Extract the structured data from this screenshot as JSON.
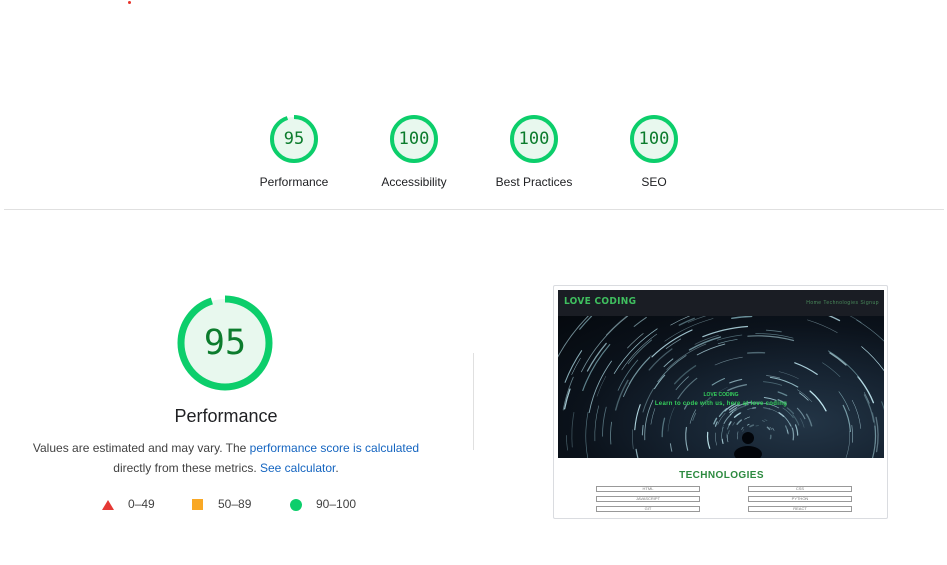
{
  "scores": [
    {
      "value": "95",
      "label": "Performance",
      "fraction": 0.95
    },
    {
      "value": "100",
      "label": "Accessibility",
      "fraction": 1.0
    },
    {
      "value": "100",
      "label": "Best Practices",
      "fraction": 1.0
    },
    {
      "value": "100",
      "label": "SEO",
      "fraction": 1.0
    }
  ],
  "main": {
    "score": "95",
    "fraction": 0.95,
    "title": "Performance",
    "desc_before": "Values are estimated and may vary. The ",
    "desc_link1": "performance score is calculated",
    "desc_mid": "directly from these metrics. ",
    "desc_link2": "See calculator",
    "desc_end": "."
  },
  "legend": [
    {
      "shape": "triangle",
      "range": "0–49",
      "color": "#e53935"
    },
    {
      "shape": "square",
      "range": "50–89",
      "color": "#f9a825"
    },
    {
      "shape": "circle",
      "range": "90–100",
      "color": "#0cce6b"
    }
  ],
  "screenshot": {
    "logo": "LOVE CODING",
    "nav_links": "Home  Technologies  Signup",
    "hero_title": "LOVE CODING",
    "hero_subtitle": "Learn to code with us, here at love coding",
    "section_title": "TECHNOLOGIES",
    "tech_left": [
      "HTML",
      "JAVASCRIPT",
      "GIT"
    ],
    "tech_right": [
      "CSS",
      "PYTHON",
      "REACT"
    ]
  },
  "colors": {
    "pass_ring": "#0cce6b",
    "pass_fill": "#e8f8ee",
    "pass_text": "#0c7c2d",
    "link": "#1565c0"
  }
}
